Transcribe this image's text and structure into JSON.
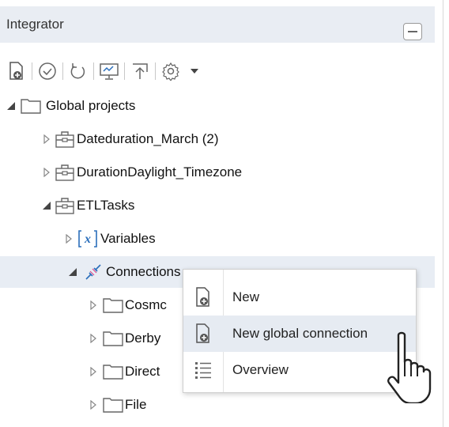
{
  "panel": {
    "title": "Integrator",
    "collapse_icon": "minus-icon"
  },
  "toolbar": {
    "items": [
      "new-file-icon",
      "check-circle-icon",
      "refresh-icon",
      "monitor-icon",
      "upload-icon",
      "gear-icon",
      "dropdown-caret-icon"
    ]
  },
  "tree": {
    "global_projects": "Global projects",
    "dateduration": "Dateduration_March (2)",
    "durationdaylight": "DurationDaylight_Timezone",
    "etltasks": "ETLTasks",
    "variables": "Variables",
    "connections": "Connections",
    "cosmos": "Cosmc",
    "derby": "Derby",
    "direct": "Direct",
    "file": "File"
  },
  "context_menu": {
    "items": [
      {
        "label": "New",
        "icon": "new-doc-icon"
      },
      {
        "label": "New global connection",
        "icon": "new-doc-icon"
      },
      {
        "label": "Overview",
        "icon": "list-icon"
      }
    ]
  },
  "colors": {
    "header_bg": "#e9edf3",
    "selected_bg": "#e8edf4",
    "hover_bg": "#e6ebf2",
    "accent_blue": "#2a6ebb"
  }
}
